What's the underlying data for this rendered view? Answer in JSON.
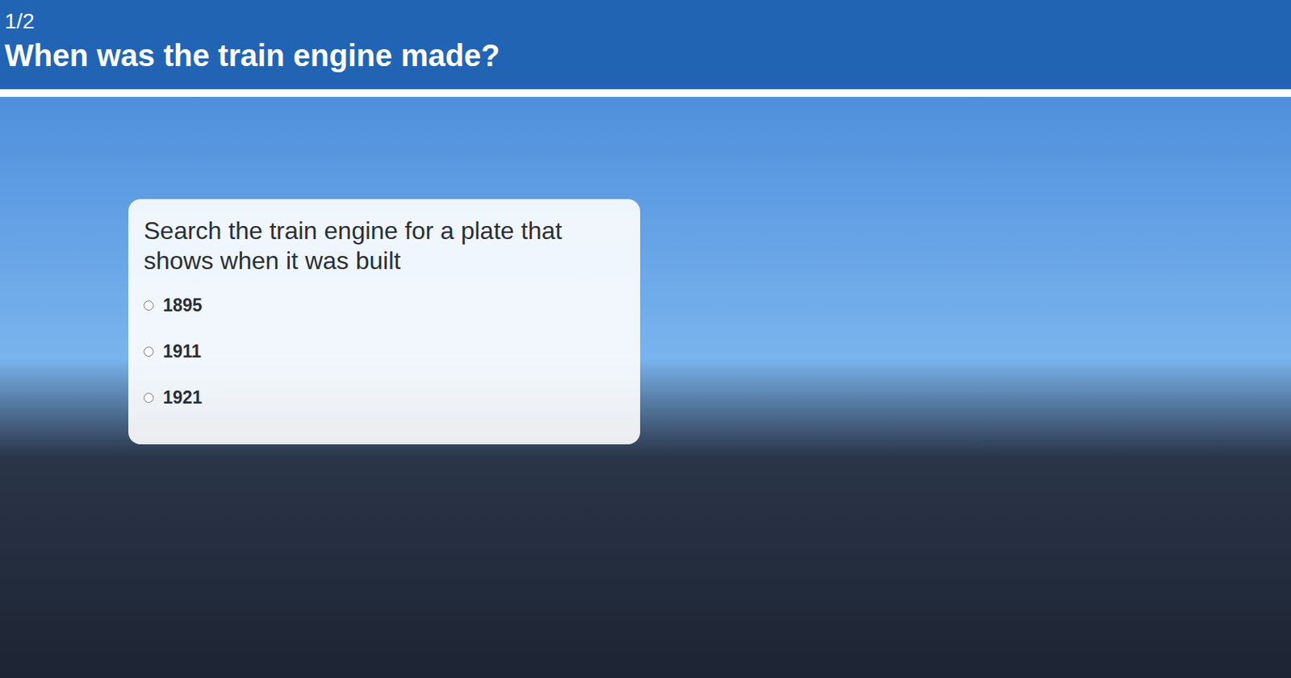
{
  "header": {
    "counter": "1/2",
    "title": "When was the train engine made?"
  },
  "question": {
    "prompt": "Search the train engine for a plate that shows when it was built",
    "options": [
      {
        "label": "1895",
        "selected": false
      },
      {
        "label": "1911",
        "selected": false
      },
      {
        "label": "1921",
        "selected": false
      }
    ]
  }
}
